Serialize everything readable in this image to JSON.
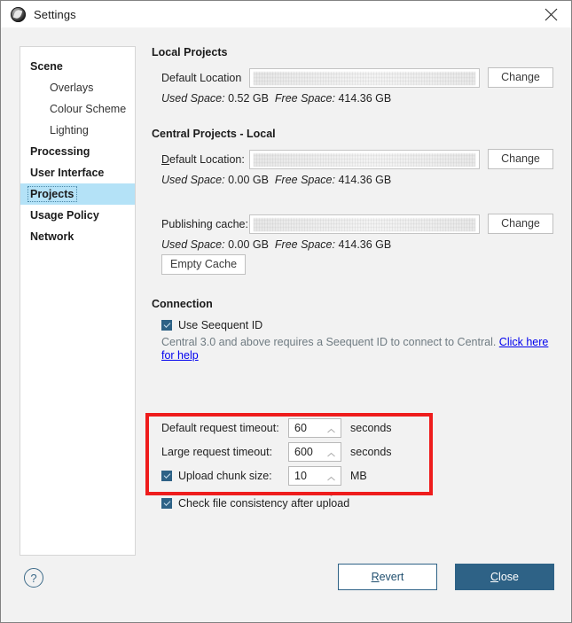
{
  "window": {
    "title": "Settings",
    "app_icon": "app-logo-icon",
    "close_icon": "close-icon"
  },
  "sidebar": {
    "items": [
      {
        "label": "Scene",
        "level": "top",
        "selected": false
      },
      {
        "label": "Overlays",
        "level": "child",
        "selected": false
      },
      {
        "label": "Colour Scheme",
        "level": "child",
        "selected": false
      },
      {
        "label": "Lighting",
        "level": "child",
        "selected": false
      },
      {
        "label": "Processing",
        "level": "top",
        "selected": false
      },
      {
        "label": "User Interface",
        "level": "top",
        "selected": false
      },
      {
        "label": "Projects",
        "level": "top",
        "selected": true
      },
      {
        "label": "Usage Policy",
        "level": "top",
        "selected": false
      },
      {
        "label": "Network",
        "level": "top",
        "selected": false
      }
    ]
  },
  "local_projects": {
    "heading": "Local Projects",
    "location_label": "Default Location",
    "location_value": "",
    "change_label": "Change",
    "used_space_label": "Used Space:",
    "used_space_value": "0.52 GB",
    "free_space_label": "Free Space:",
    "free_space_value": "414.36 GB"
  },
  "central_projects": {
    "heading": "Central Projects - Local",
    "location_label_pre": "D",
    "location_label_post": "efault Location:",
    "location_value": "",
    "change_label": "Change",
    "used_space_label": "Used Space:",
    "used_space_value": "0.00 GB",
    "free_space_label": "Free Space:",
    "free_space_value": "414.36 GB",
    "cache_label": "Publishing cache:",
    "cache_value": "",
    "cache_change_label": "Change",
    "cache_used_space_label": "Used Space:",
    "cache_used_space_value": "0.00 GB",
    "cache_free_space_label": "Free Space:",
    "cache_free_space_value": "414.36 GB",
    "empty_cache_label": "Empty Cache"
  },
  "connection": {
    "heading": "Connection",
    "use_seequent_id_label": "Use Seequent ID",
    "use_seequent_id_checked": true,
    "info_text": "Central 3.0 and above requires a Seequent ID to connect to Central. ",
    "info_link": "Click here for help",
    "default_timeout_label": "Default request timeout:",
    "default_timeout_value": "60",
    "default_timeout_unit": "seconds",
    "large_timeout_label": "Large request timeout:",
    "large_timeout_value": "600",
    "large_timeout_unit": "seconds",
    "chunk_size_label": "Upload chunk size:",
    "chunk_size_value": "10",
    "chunk_size_unit": "MB",
    "chunk_size_checked": true,
    "check_consistency_label": "Check file consistency after upload",
    "check_consistency_checked": true
  },
  "footer": {
    "help_label": "?",
    "revert_label_pre": "R",
    "revert_label_post": "evert",
    "close_label_pre": "C",
    "close_label_post": "lose"
  },
  "annotation": {
    "highlight_color": "#ee1c1c"
  }
}
